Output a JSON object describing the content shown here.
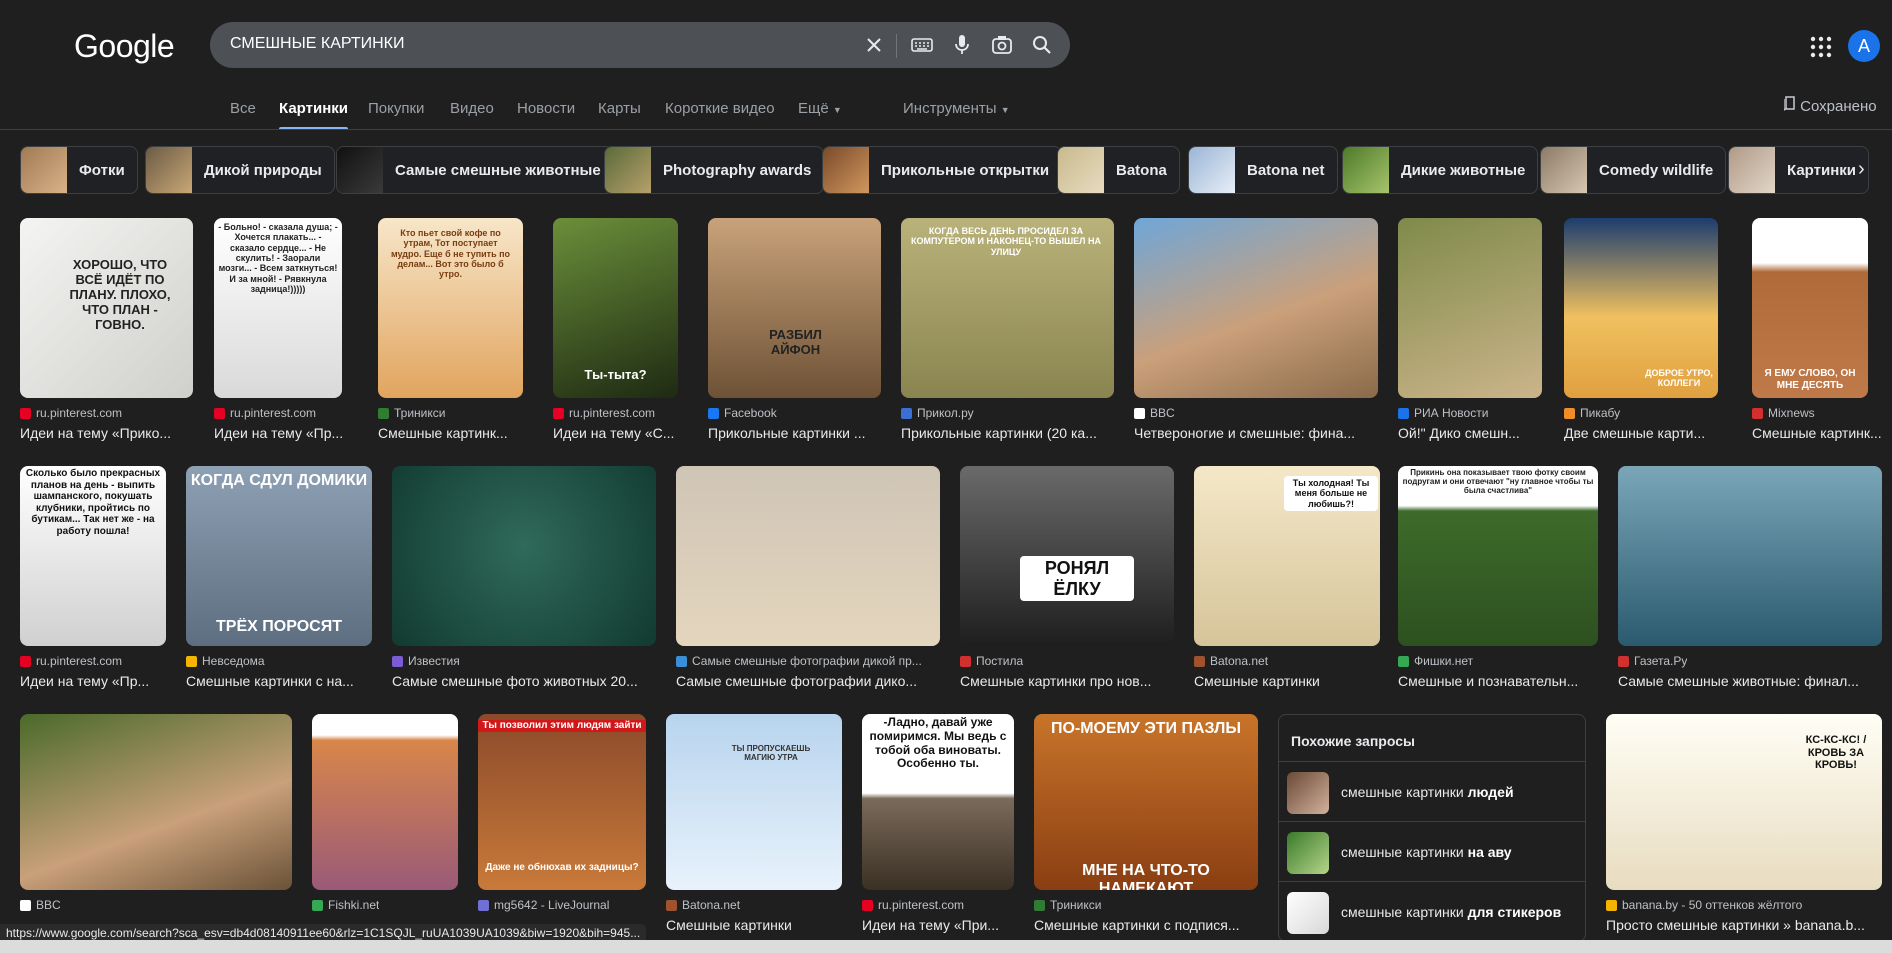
{
  "logo": "Google",
  "search": {
    "query": "СМЕШНЫЕ КАРТИНКИ"
  },
  "user": {
    "initial": "A"
  },
  "tabs": [
    "Все",
    "Картинки",
    "Покупки",
    "Видео",
    "Новости",
    "Карты",
    "Короткие видео",
    "Ещё"
  ],
  "tools_label": "Инструменты",
  "saved_label": "Сохранено",
  "chips": [
    "Фотки",
    "Дикой природы",
    "Самые смешные животные",
    "Photography awards",
    "Прикольные открытки",
    "Batona",
    "Batona net",
    "Дикие животные",
    "Comedy wildlife",
    "Картинки"
  ],
  "results": [
    {
      "source": "ru.pinterest.com",
      "title": "Идеи на тему «Прико...",
      "overlay": "ХОРОШО, ЧТО ВСЁ ИДЁТ ПО ПЛАНУ. ПЛОХО, ЧТО ПЛАН - ГОВНО."
    },
    {
      "source": "ru.pinterest.com",
      "title": "Идеи на тему «Пр...",
      "overlay": "- Больно! - сказала душа; - Хочется плакать... - сказало сердце... - Не скулить! - Заорали мозги... - Всем заткнуться! И за мной! - Рявкнула задница!)))))"
    },
    {
      "source": "Триникси",
      "title": "Смешные картинк...",
      "overlay": "Кто пьет свой кофе по утрам, Тот поступает мудро. Еще б не тупить по делам... Вот это было б утро."
    },
    {
      "source": "ru.pinterest.com",
      "title": "Идеи на тему «С...",
      "overlay": "Ты-тыта?"
    },
    {
      "source": "Facebook",
      "title": "Прикольные картинки ...",
      "overlay": "РАЗБИЛ АЙФОН"
    },
    {
      "source": "Прикол.ру",
      "title": "Прикольные картинки (20 ка...",
      "overlay": "КОГДА ВЕСЬ ДЕНЬ ПРОСИДЕЛ ЗА КОМПУТЕРОМ И НАКОНЕЦ-ТО ВЫШЕЛ НА УЛИЦУ"
    },
    {
      "source": "BBC",
      "title": "Четвероногие и смешные: фина...",
      "overlay": ""
    },
    {
      "source": "РИА Новости",
      "title": "Ой!\" Дико смешн...",
      "overlay": ""
    },
    {
      "source": "Пикабу",
      "title": "Две смешные карти...",
      "overlay": "ДОБРОЕ УТРО, КОЛЛЕГИ"
    },
    {
      "source": "Mixnews",
      "title": "Смешные картинк...",
      "overlay": "Я ЕМУ СЛОВО, ОН МНЕ ДЕСЯТЬ"
    },
    {
      "source": "ru.pinterest.com",
      "title": "Идеи на тему «Пр...",
      "overlay": "Сколько было прекрасных планов на день - выпить шампанского, покушать клубники, пройтись по бутикам... Так нет же - на работу пошла!"
    },
    {
      "source": "Невседома",
      "title": "Смешные картинки с на...",
      "overlay": "КОГДА СДУЛ ДОМИКИ ТРЁХ ПОРОСЯТ"
    },
    {
      "source": "Известия",
      "title": "Самые смешные фото животных 20...",
      "overlay": ""
    },
    {
      "source": "Самые смешные фотографии дикой пр...",
      "title": "Самые смешные фотографии дико...",
      "overlay": ""
    },
    {
      "source": "Постила",
      "title": "Смешные картинки про нов...",
      "overlay": "РОНЯЛ ЁЛКУ"
    },
    {
      "source": "Batona.net",
      "title": "Смешные картинки",
      "overlay": "Ты холодная! Ты меня больше не любишь?!"
    },
    {
      "source": "Фишки.нет",
      "title": "Смешные и познавательн...",
      "overlay": "Прикинь она показывает твою фотку своим подругам и они отвечают \"ну главное чтобы ты была счастлива\""
    },
    {
      "source": "Газета.Ру",
      "title": "Самые смешные животные: финал...",
      "overlay": ""
    },
    {
      "source": "BBC",
      "title": "",
      "overlay": ""
    },
    {
      "source": "Fishki.net",
      "title": "",
      "overlay": ""
    },
    {
      "source": "mg5642 - LiveJournal",
      "title": "",
      "overlay": "Ты позволил этим людям зайти / Даже не обнюхав их задницы?"
    },
    {
      "source": "Batona.net",
      "title": "Смешные картинки",
      "overlay": "ТЫ ПРОПУСКАЕШЬ МАГИЮ УТРА"
    },
    {
      "source": "ru.pinterest.com",
      "title": "Идеи на тему «При...",
      "overlay": "-Ладно, давай уже помиримся. Мы ведь с тобой оба виноваты. Особенно ты."
    },
    {
      "source": "Триникси",
      "title": "Смешные картинки с подпися...",
      "overlay": "ПО-МОЕМУ ЭТИ ПАЗЛЫ / МНЕ НА ЧТО-ТО НАМЕКАЮТ"
    },
    {
      "source": "banana.by - 50 оттенков жёлтого",
      "title": "Просто смешные картинки » banana.b...",
      "overlay": "КС-КС-КС! / КРОВЬ ЗА КРОВЬ!"
    }
  ],
  "related": {
    "heading": "Похожие запросы",
    "items": [
      {
        "prefix": "смешные картинки ",
        "bold": "людей"
      },
      {
        "prefix": "смешные картинки ",
        "bold": "на аву"
      },
      {
        "prefix": "смешные картинки ",
        "bold": "для стикеров"
      }
    ]
  },
  "status_url": "https://www.google.com/search?sca_esv=db4d08140911ee60&rlz=1C1SQJL_ruUA1039UA1039&biw=1920&bih=945..."
}
